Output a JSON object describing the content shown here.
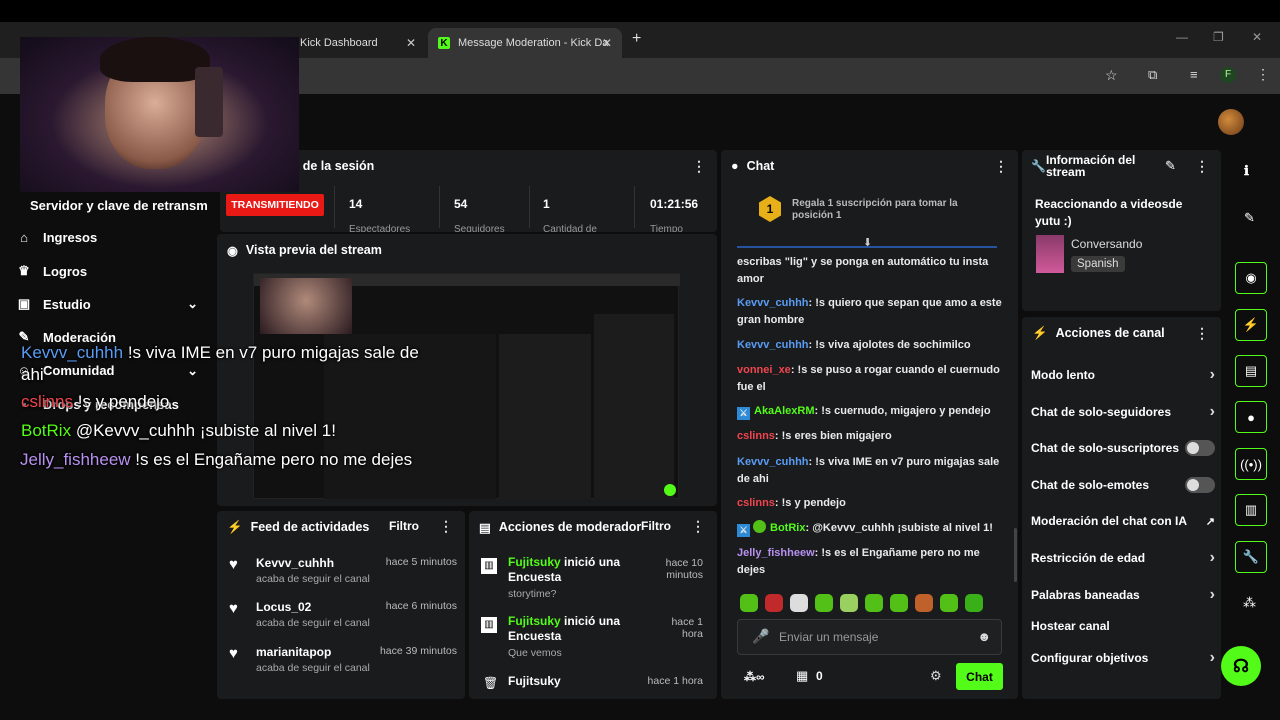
{
  "browser": {
    "tabs": [
      {
        "label": "Kick Dashboard"
      },
      {
        "label": "Message Moderation - Kick Da"
      }
    ],
    "new_tab": "+",
    "profile_initial": "F"
  },
  "session": {
    "title": "ón de la sesión",
    "status": "TRANSMITIENDO",
    "stats": [
      {
        "value": "14",
        "label": "Espectadores"
      },
      {
        "value": "54",
        "label": "Seguidores"
      },
      {
        "value": "1",
        "label": "Cantidad de"
      },
      {
        "value": "01:21:56",
        "label": "Tiempo"
      }
    ]
  },
  "sidebar": {
    "server_key": "Servidor y clave de retransm",
    "items": [
      {
        "label": "Ingresos",
        "icon": "bank-icon"
      },
      {
        "label": "Logros",
        "icon": "trophy-icon"
      },
      {
        "label": "Estudio",
        "icon": "studio-icon"
      },
      {
        "label": "Moderación",
        "icon": "wrench-icon"
      },
      {
        "label": "Comunidad",
        "icon": "community-icon"
      },
      {
        "label": "Drops y recompensas",
        "icon": "gift-icon"
      }
    ]
  },
  "preview": {
    "title": "Vista previa del stream"
  },
  "feed": {
    "title": "Feed de actividades",
    "filter": "Filtro",
    "items": [
      {
        "user": "Kevvv_cuhhh",
        "time": "hace 5 minutos",
        "desc": "acaba de seguir el canal"
      },
      {
        "user": "Locus_02",
        "time": "hace 6 minutos",
        "desc": "acaba de seguir el canal"
      },
      {
        "user": "marianitapop",
        "time": "hace 39 minutos",
        "desc": "acaba de seguir el canal"
      }
    ]
  },
  "modactions": {
    "title": "Acciones de moderador",
    "filter": "Filtro",
    "items": [
      {
        "user": "Fujitsuky",
        "action": "inició una Encuesta",
        "time": "hace 10 minutos",
        "detail": "storytime?"
      },
      {
        "user": "Fujitsuky",
        "action": "inició una Encuesta",
        "time": "hace 1 hora",
        "detail": "Que vemos"
      },
      {
        "user": "Fujitsuky",
        "action": "",
        "time": "hace 1 hora",
        "detail": ""
      }
    ]
  },
  "chat": {
    "title": "Chat",
    "gift_banner": "Regala 1 suscripción para tomar la posición 1",
    "gift_rank": "1",
    "messages": [
      {
        "user": "",
        "text": "escribas \"lig\" y se ponga en automático tu insta amor"
      },
      {
        "user": "Kevvv_cuhhh",
        "text": "!s quiero que sepan que amo a este gran hombre"
      },
      {
        "user": "Kevvv_cuhhh",
        "text": "!s viva ajolotes de sochimilco"
      },
      {
        "user": "vonnei_xe",
        "text": "!s se puso a rogar cuando el cuernudo fue el"
      },
      {
        "user": "AkaAlexRM",
        "text": "!s cuernudo, migajero y pendejo"
      },
      {
        "user": "cslinns",
        "text": "!s eres bien migajero"
      },
      {
        "user": "Kevvv_cuhhh",
        "text": "!s viva IME en v7 puro migajas sale de ahi"
      },
      {
        "user": "cslinns",
        "text": "!s y pendejo"
      },
      {
        "user": "BotRix",
        "text": "@Kevvv_cuhhh ¡subiste al nivel 1!"
      },
      {
        "user": "Jelly_fishheew",
        "text": "!s es el Engañame pero no me dejes"
      }
    ],
    "input_placeholder": "Enviar un mensaje",
    "points": "0",
    "send": "Chat"
  },
  "info": {
    "title": "Información del stream",
    "stream_title": "Reaccionando a videosde yutu :)",
    "category": "Conversando",
    "language": "Spanish"
  },
  "channel_actions": {
    "title": "Acciones de canal",
    "items": [
      {
        "label": "Modo lento",
        "control": "chevron"
      },
      {
        "label": "Chat de solo-seguidores",
        "control": "chevron"
      },
      {
        "label": "Chat de solo-suscriptores",
        "control": "toggle"
      },
      {
        "label": "Chat de solo-emotes",
        "control": "toggle"
      },
      {
        "label": "Moderación del chat con IA",
        "control": "external"
      },
      {
        "label": "Restricción de edad",
        "control": "chevron"
      },
      {
        "label": "Palabras baneadas",
        "control": "chevron"
      },
      {
        "label": "Hostear canal",
        "control": "none"
      },
      {
        "label": "Configurar objetivos",
        "control": "chevron"
      }
    ]
  },
  "overlay": {
    "lines": [
      {
        "user": "Kevvv_cuhhh",
        "text": "!s viva IME en v7 puro migajas sale de ahi"
      },
      {
        "user": "cslinns",
        "text": "!s y pendejo"
      },
      {
        "user": "BotRix",
        "text": "@Kevvv_cuhhh ¡subiste al nivel 1!"
      },
      {
        "user": "Jelly_fishheew",
        "text": "!s es el Engañame pero no me dejes"
      }
    ]
  },
  "colors": {
    "accent": "#53fc18",
    "panel": "#1a1b1d",
    "live": "#e91916"
  }
}
